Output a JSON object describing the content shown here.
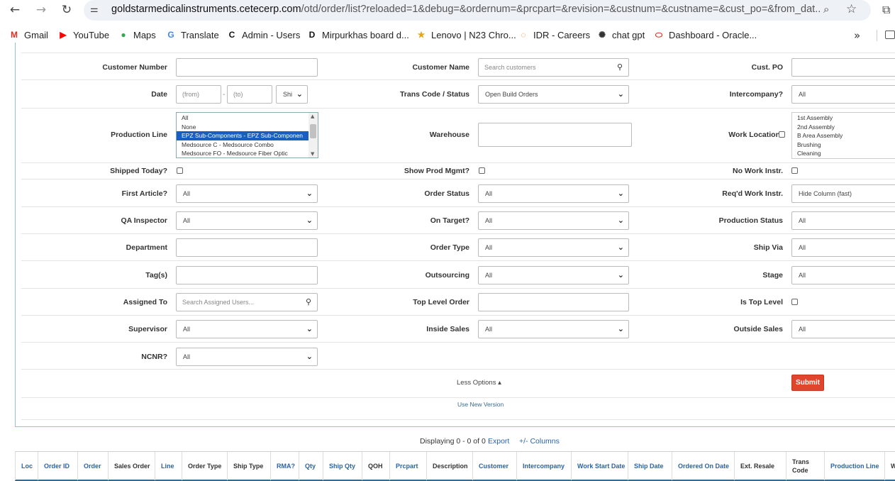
{
  "browser": {
    "url_host": "goldstarmedicalinstruments.cetecerp.com",
    "url_rest": "/otd/order/list?reloaded=1&debug=&ordernum=&prcpart=&revision=&custnum=&custname=&cust_po=&from_dat...",
    "bookmarks": [
      {
        "label": "Gmail",
        "icon": "gmail-icon",
        "glyph": "M",
        "color": "#d93025"
      },
      {
        "label": "YouTube",
        "icon": "youtube-icon",
        "glyph": "▶",
        "color": "#ff0000"
      },
      {
        "label": "Maps",
        "icon": "maps-icon",
        "glyph": "●",
        "color": "#34a853"
      },
      {
        "label": "Translate",
        "icon": "translate-icon",
        "glyph": "G",
        "color": "#4285f4"
      },
      {
        "label": "Admin - Users",
        "icon": "c-logo-icon",
        "glyph": "C",
        "color": "#111111"
      },
      {
        "label": "Mirpurkhas board d...",
        "icon": "d-logo-icon",
        "glyph": "D",
        "color": "#111111"
      },
      {
        "label": "Lenovo | N23 Chro...",
        "icon": "star-logo-icon",
        "glyph": "★",
        "color": "#e8a317"
      },
      {
        "label": "IDR - Careers",
        "icon": "idr-logo-icon",
        "glyph": "◌",
        "color": "#e87722"
      },
      {
        "label": "chat gpt",
        "icon": "openai-icon",
        "glyph": "✺",
        "color": "#333333"
      },
      {
        "label": "Dashboard - Oracle...",
        "icon": "oracle-icon",
        "glyph": "⬭",
        "color": "#e0301e"
      }
    ]
  },
  "filters": {
    "customer_number": {
      "label": "Customer Number",
      "value": ""
    },
    "customer_name": {
      "label": "Customer Name",
      "placeholder": "Search customers"
    },
    "cust_po": {
      "label": "Cust. PO",
      "value": ""
    },
    "date": {
      "label": "Date",
      "from_placeholder": "(from)",
      "to_placeholder": "(to)",
      "dash": "-",
      "type_value": "Shi"
    },
    "trans_code": {
      "label": "Trans Code / Status",
      "value": "Open Build Orders"
    },
    "intercompany": {
      "label": "Intercompany?",
      "value": "All"
    },
    "production_line": {
      "label": "Production Line",
      "options": [
        "All",
        "None",
        "EPZ Sub-Components - EPZ Sub-Componen",
        "Medsource C - Medsource Combo",
        "Medsource FO - Medsource Fiber Optic"
      ],
      "selected_index": 2
    },
    "warehouse": {
      "label": "Warehouse",
      "value": ""
    },
    "work_location": {
      "label": "Work Location",
      "options": [
        "1st Assembly",
        "2nd Assembly",
        "B Area Assembly",
        "Brushing",
        "Cleaning"
      ]
    },
    "shipped_today": {
      "label": "Shipped Today?"
    },
    "show_prod_mgmt": {
      "label": "Show Prod Mgmt?"
    },
    "no_work_instr": {
      "label": "No Work Instr."
    },
    "first_article": {
      "label": "First Article?",
      "value": "All"
    },
    "order_status": {
      "label": "Order Status",
      "value": "All"
    },
    "reqd_work_instr": {
      "label": "Req'd Work Instr.",
      "value": "Hide Column (fast)"
    },
    "qa_inspector": {
      "label": "QA Inspector",
      "value": "All"
    },
    "on_target": {
      "label": "On Target?",
      "value": "All"
    },
    "production_status": {
      "label": "Production Status",
      "value": "All"
    },
    "department": {
      "label": "Department",
      "value": ""
    },
    "order_type": {
      "label": "Order Type",
      "value": "All"
    },
    "ship_via": {
      "label": "Ship Via",
      "value": "All"
    },
    "tags": {
      "label": "Tag(s)",
      "value": ""
    },
    "outsourcing": {
      "label": "Outsourcing",
      "value": "All"
    },
    "stage": {
      "label": "Stage",
      "value": "All"
    },
    "assigned_to": {
      "label": "Assigned To",
      "placeholder": "Search Assigned Users..."
    },
    "top_level_order": {
      "label": "Top Level Order",
      "value": ""
    },
    "is_top_level": {
      "label": "Is Top Level"
    },
    "supervisor": {
      "label": "Supervisor",
      "value": "All"
    },
    "inside_sales": {
      "label": "Inside Sales",
      "value": "All"
    },
    "outside_sales": {
      "label": "Outside Sales",
      "value": "All"
    },
    "ncnr": {
      "label": "NCNR?",
      "value": "All"
    }
  },
  "actions": {
    "less_options": "Less Options ▴",
    "submit": "Submit",
    "use_new_version": "Use New Version"
  },
  "results": {
    "displaying": "Displaying 0 - 0 of 0",
    "export": "Export",
    "columns": "+/- Columns"
  },
  "table": {
    "columns": [
      {
        "label": "Loc",
        "link": true
      },
      {
        "label": "Order ID",
        "link": true
      },
      {
        "label": "Order",
        "link": true
      },
      {
        "label": "Sales Order",
        "link": false
      },
      {
        "label": "Line",
        "link": true
      },
      {
        "label": "Order Type",
        "link": false
      },
      {
        "label": "Ship Type",
        "link": false
      },
      {
        "label": "RMA?",
        "link": true
      },
      {
        "label": "Qty",
        "link": true
      },
      {
        "label": "Ship Qty",
        "link": true
      },
      {
        "label": "QOH",
        "link": false
      },
      {
        "label": "Prcpart",
        "link": true
      },
      {
        "label": "Description",
        "link": false
      },
      {
        "label": "Customer",
        "link": true
      },
      {
        "label": "Intercompany",
        "link": true
      },
      {
        "label": "Work Start Date",
        "link": true
      },
      {
        "label": "Ship Date",
        "link": true
      },
      {
        "label": "Ordered On Date",
        "link": true
      },
      {
        "label": "Ext. Resale",
        "link": false
      },
      {
        "label": "Trans Code",
        "link": false
      },
      {
        "label": "Production Line",
        "link": true
      },
      {
        "label": "W St",
        "link": false
      }
    ]
  }
}
